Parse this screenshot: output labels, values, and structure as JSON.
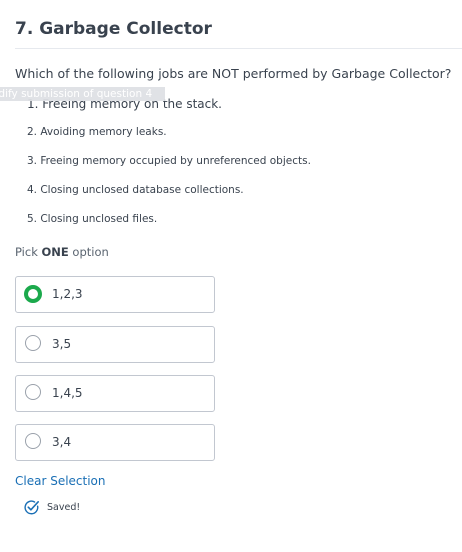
{
  "question": {
    "title": "7. Garbage Collector",
    "prompt": "Which of the following jobs are NOT performed by Garbage Collector?",
    "tooltip": "odify submission of question 4",
    "items": [
      "1. Freeing memory on the stack.",
      "2.  Avoiding memory leaks.",
      "3. Freeing memory occupied by unreferenced objects.",
      "4. Closing unclosed database collections.",
      "5.  Closing unclosed files."
    ]
  },
  "pick": {
    "prefix": "Pick ",
    "emphasis": "ONE",
    "suffix": " option"
  },
  "options": [
    {
      "label": "1,2,3",
      "selected": true
    },
    {
      "label": "3,5",
      "selected": false
    },
    {
      "label": "1,4,5",
      "selected": false
    },
    {
      "label": "3,4",
      "selected": false
    }
  ],
  "clear_label": "Clear Selection",
  "saved_label": "Saved!",
  "colors": {
    "selected_radio": "#1ba94c",
    "link": "#1a6fb5",
    "saved_icon": "#1a6fb5"
  },
  "icons": {
    "saved": "check-circle-icon",
    "radio": "radio-icon"
  }
}
